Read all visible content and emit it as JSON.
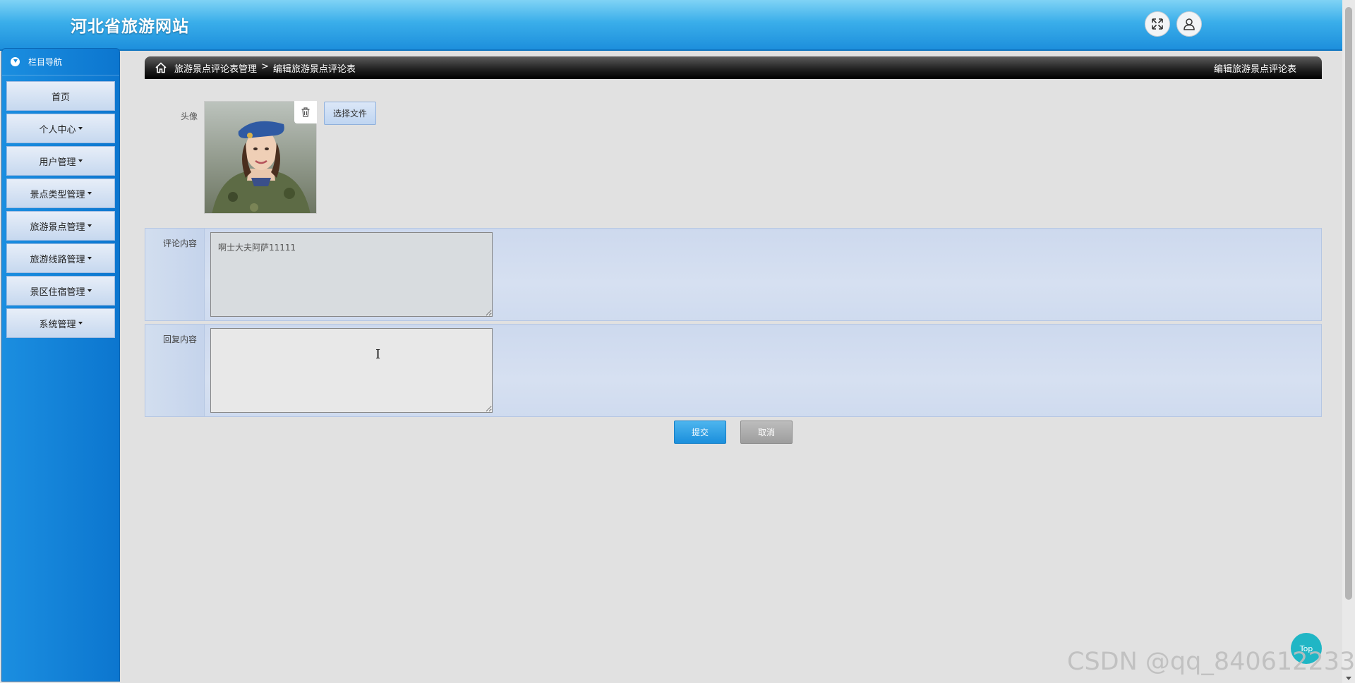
{
  "header": {
    "site_title": "河北省旅游网站",
    "fullscreen_icon": "expand-icon",
    "user_icon": "user-icon"
  },
  "sidebar": {
    "title": "栏目导航",
    "items": [
      {
        "label": "首页",
        "has_caret": false
      },
      {
        "label": "个人中心",
        "has_caret": true
      },
      {
        "label": "用户管理",
        "has_caret": true
      },
      {
        "label": "景点类型管理",
        "has_caret": true
      },
      {
        "label": "旅游景点管理",
        "has_caret": true
      },
      {
        "label": "旅游线路管理",
        "has_caret": true
      },
      {
        "label": "景区住宿管理",
        "has_caret": true
      },
      {
        "label": "系统管理",
        "has_caret": true
      }
    ]
  },
  "breadcrumb": {
    "parent": "旅游景点评论表管理",
    "separator": ">",
    "current": "编辑旅游景点评论表",
    "right_title": "编辑旅游景点评论表"
  },
  "form": {
    "avatar_label": "头像",
    "choose_file_label": "选择文件",
    "comment_label": "评论内容",
    "comment_value": "啊士大夫阿萨11111",
    "reply_label": "回复内容",
    "reply_value": "",
    "submit_label": "提交",
    "cancel_label": "取消"
  },
  "top_button_label": "Top",
  "watermark": "CSDN @qq_840612233"
}
